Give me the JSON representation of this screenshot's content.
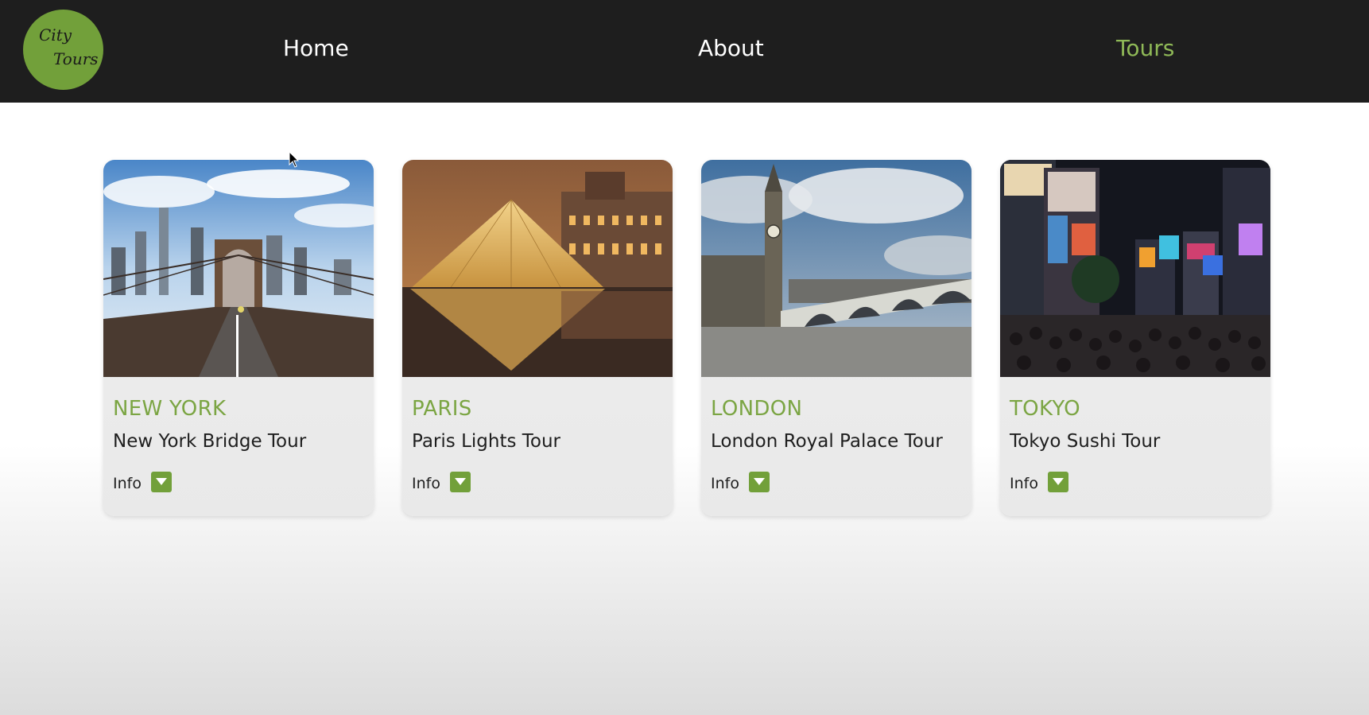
{
  "logo": {
    "line1": "City",
    "line2": "Tours"
  },
  "nav": {
    "items": [
      {
        "label": "Home",
        "active": false
      },
      {
        "label": "About",
        "active": false
      },
      {
        "label": "Tours",
        "active": true
      }
    ]
  },
  "tours": [
    {
      "city": "NEW YORK",
      "name": "New York Bridge Tour",
      "info_label": "Info",
      "image": "brooklyn-bridge-photo"
    },
    {
      "city": "PARIS",
      "name": "Paris Lights Tour",
      "info_label": "Info",
      "image": "louvre-pyramid-photo"
    },
    {
      "city": "LONDON",
      "name": "London Royal Palace Tour",
      "info_label": "Info",
      "image": "big-ben-westminster-photo"
    },
    {
      "city": "TOKYO",
      "name": "Tokyo Sushi Tour",
      "info_label": "Info",
      "image": "shibuya-crossing-photo"
    }
  ],
  "colors": {
    "navbar_bg": "#1e1e1e",
    "accent": "#7ba543",
    "active_nav": "#8fb957"
  }
}
